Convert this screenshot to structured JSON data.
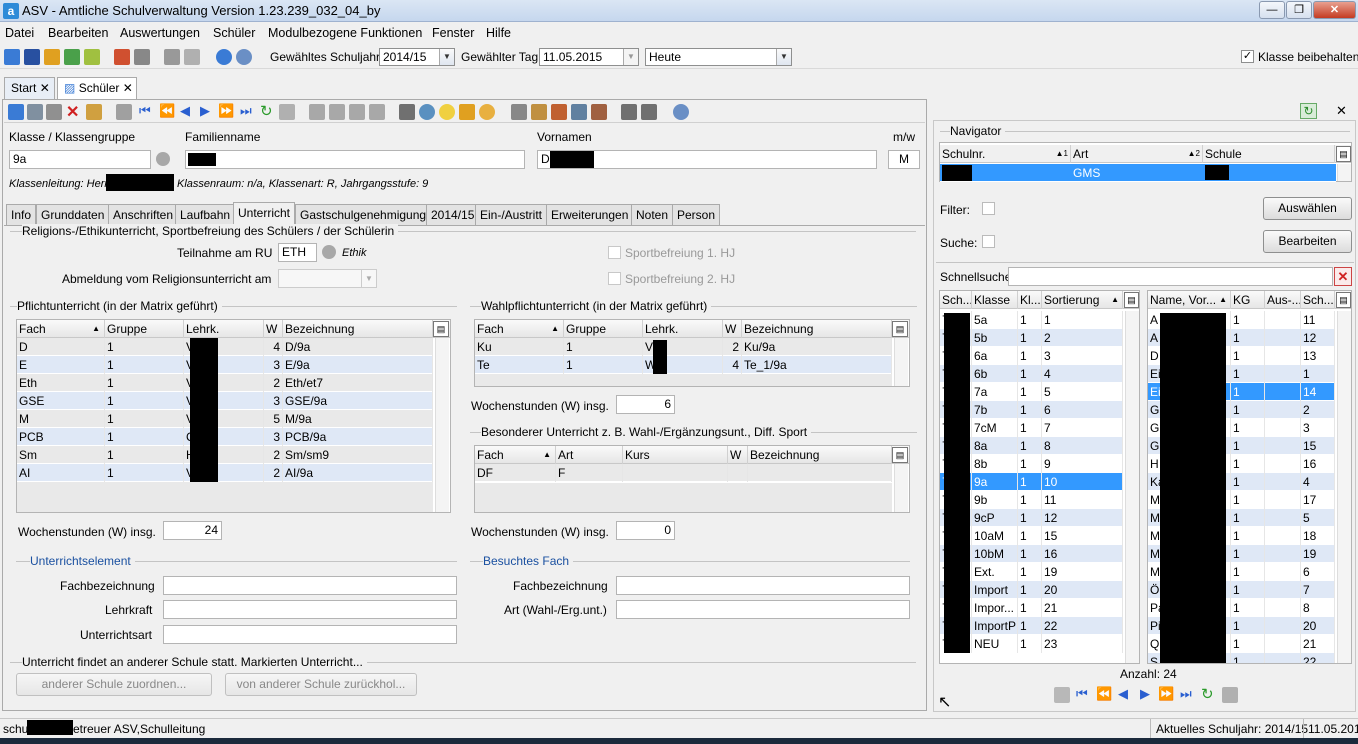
{
  "window": {
    "title": "ASV - Amtliche Schulverwaltung Version 1.23.239_032_04_by",
    "app_icon": "a"
  },
  "menu": [
    "Datei",
    "Bearbeiten",
    "Auswertungen",
    "Schüler",
    "Modulbezogene Funktionen",
    "Fenster",
    "Hilfe"
  ],
  "toolbar": {
    "schuljahr_label": "Gewähltes Schuljahr",
    "schuljahr_value": "2014/15",
    "tag_label": "Gewählter Tag",
    "tag_value": "11.05.2015",
    "heute_value": "Heute",
    "klasse_beibehalten": "Klasse beibehalten"
  },
  "tabs": [
    {
      "label": "Start"
    },
    {
      "label": "Schüler"
    }
  ],
  "header": {
    "klasse_label": "Klasse / Klassengruppe",
    "klasse_value": "9a",
    "familienname_label": "Familienname",
    "vornamen_label": "Vornamen",
    "vornamen_prefix": "D",
    "mw_label": "m/w",
    "mw_value": "M",
    "klassenleitung_prefix": "Klassenleitung: Herr",
    "klasseninfo": "Klassenraum: n/a, Klassenart: R, Jahrgangsstufe: 9"
  },
  "subtabs": [
    "Info",
    "Grunddaten",
    "Anschriften",
    "Laufbahn",
    "Unterricht",
    "Gastschulgenehmigung",
    "2014/15",
    "Ein-/Austritt",
    "Erweiterungen",
    "Noten",
    "Person"
  ],
  "religion": {
    "group_title": "Religions-/Ethikunterricht, Sportbefreiung des Schülers / der Schülerin",
    "teilnahme_label": "Teilnahme am RU",
    "teilnahme_value": "ETH",
    "teilnahme_hint": "Ethik",
    "abmeldung_label": "Abmeldung vom Religionsunterricht am",
    "sport1": "Sportbefreiung 1. HJ",
    "sport2": "Sportbefreiung 2. HJ"
  },
  "pflicht": {
    "title": "Pflichtunterricht (in der Matrix geführt)",
    "columns": [
      "Fach",
      "Gruppe",
      "Lehrk.",
      "W",
      "Bezeichnung"
    ],
    "rows": [
      {
        "fach": "D",
        "gruppe": "1",
        "lehrk": "V",
        "w": "4",
        "bez": "D/9a"
      },
      {
        "fach": "E",
        "gruppe": "1",
        "lehrk": "V",
        "w": "3",
        "bez": "E/9a"
      },
      {
        "fach": "Eth",
        "gruppe": "1",
        "lehrk": "V",
        "w": "2",
        "bez": "Eth/et7"
      },
      {
        "fach": "GSE",
        "gruppe": "1",
        "lehrk": "V",
        "w": "3",
        "bez": "GSE/9a"
      },
      {
        "fach": "M",
        "gruppe": "1",
        "lehrk": "V",
        "w": "5",
        "bez": "M/9a"
      },
      {
        "fach": "PCB",
        "gruppe": "1",
        "lehrk": "C",
        "w": "3",
        "bez": "PCB/9a"
      },
      {
        "fach": "Sm",
        "gruppe": "1",
        "lehrk": "H",
        "w": "2",
        "bez": "Sm/sm9"
      },
      {
        "fach": "AI",
        "gruppe": "1",
        "lehrk": "V",
        "w": "2",
        "bez": "AI/9a"
      }
    ],
    "wochenstunden_label": "Wochenstunden (W) insg.",
    "wochenstunden_value": "24"
  },
  "wahlpflicht": {
    "title": "Wahlpflichtunterricht (in der Matrix geführt)",
    "columns": [
      "Fach",
      "Gruppe",
      "Lehrk.",
      "W",
      "Bezeichnung"
    ],
    "rows": [
      {
        "fach": "Ku",
        "gruppe": "1",
        "lehrk": "V",
        "w": "2",
        "bez": "Ku/9a"
      },
      {
        "fach": "Te",
        "gruppe": "1",
        "lehrk": "W",
        "w": "4",
        "bez": "Te_1/9a"
      }
    ],
    "wochenstunden_label": "Wochenstunden (W) insg.",
    "wochenstunden_value": "6"
  },
  "besonderer": {
    "title": "Besonderer Unterricht z. B. Wahl-/Ergänzungsunt., Diff. Sport",
    "columns": [
      "Fach",
      "Art",
      "Kurs",
      "W",
      "Bezeichnung"
    ],
    "rows": [
      {
        "fach": "DF",
        "art": "F",
        "kurs": "",
        "w": "",
        "bez": ""
      }
    ],
    "wochenstunden_label": "Wochenstunden (W) insg.",
    "wochenstunden_value": "0"
  },
  "unterrichtselement": {
    "title": "Unterrichtselement",
    "fachbezeichnung": "Fachbezeichnung",
    "lehrkraft": "Lehrkraft",
    "unterrichtsart": "Unterrichtsart"
  },
  "besuchtes_fach": {
    "title": "Besuchtes Fach",
    "fachbezeichnung": "Fachbezeichnung",
    "art": "Art (Wahl-/Erg.unt.)"
  },
  "andere_schule": {
    "title": "Unterricht findet an anderer Schule statt. Markierten Unterricht...",
    "zuordnen": "anderer Schule zuordnen...",
    "zurueckholen": "von anderer Schule zurückhol..."
  },
  "navigator": {
    "title": "Navigator",
    "columns": [
      "Schulnr.",
      "Art",
      "Schule"
    ],
    "sort1": "1",
    "sort2": "2",
    "row_art": "GMS",
    "filter_label": "Filter:",
    "suche_label": "Suche:",
    "auswaehlen": "Auswählen",
    "bearbeiten": "Bearbeiten",
    "schnellsuche_label": "Schnellsuche",
    "class_columns": [
      "Sch...",
      "Klasse",
      "Kl...",
      "Sortierung"
    ],
    "classes": [
      {
        "k": "5a",
        "kl": "1",
        "s": "1"
      },
      {
        "k": "5b",
        "kl": "1",
        "s": "2"
      },
      {
        "k": "6a",
        "kl": "1",
        "s": "3"
      },
      {
        "k": "6b",
        "kl": "1",
        "s": "4"
      },
      {
        "k": "7a",
        "kl": "1",
        "s": "5"
      },
      {
        "k": "7b",
        "kl": "1",
        "s": "6"
      },
      {
        "k": "7cM",
        "kl": "1",
        "s": "7"
      },
      {
        "k": "8a",
        "kl": "1",
        "s": "8"
      },
      {
        "k": "8b",
        "kl": "1",
        "s": "9"
      },
      {
        "k": "9a",
        "kl": "1",
        "s": "10"
      },
      {
        "k": "9b",
        "kl": "1",
        "s": "11"
      },
      {
        "k": "9cP",
        "kl": "1",
        "s": "12"
      },
      {
        "k": "10aM",
        "kl": "1",
        "s": "15"
      },
      {
        "k": "10bM",
        "kl": "1",
        "s": "16"
      },
      {
        "k": "Ext.",
        "kl": "1",
        "s": "19"
      },
      {
        "k": "Import",
        "kl": "1",
        "s": "20"
      },
      {
        "k": "Impor...",
        "kl": "1",
        "s": "21"
      },
      {
        "k": "ImportP",
        "kl": "1",
        "s": "22"
      },
      {
        "k": "NEU",
        "kl": "1",
        "s": "23"
      }
    ],
    "class_sch_prefix": "7",
    "student_columns": [
      "Name, Vor...",
      "KG",
      "Aus-...",
      "Sch..."
    ],
    "students": [
      {
        "n": "A",
        "kg": "1",
        "sch": "11"
      },
      {
        "n": "A",
        "kg": "1",
        "sch": "12"
      },
      {
        "n": "D",
        "kg": "1",
        "sch": "13"
      },
      {
        "n": "Ei",
        "kg": "1",
        "sch": "1"
      },
      {
        "n": "Ei",
        "kg": "1",
        "sch": "14"
      },
      {
        "n": "G",
        "kg": "1",
        "sch": "2"
      },
      {
        "n": "G",
        "kg": "1",
        "sch": "3"
      },
      {
        "n": "G",
        "kg": "1",
        "sch": "15"
      },
      {
        "n": "H",
        "kg": "1",
        "sch": "16"
      },
      {
        "n": "Ka",
        "kg": "1",
        "sch": "4"
      },
      {
        "n": "M",
        "kg": "1",
        "sch": "17"
      },
      {
        "n": "M",
        "kg": "1",
        "sch": "5"
      },
      {
        "n": "M",
        "kg": "1",
        "sch": "18"
      },
      {
        "n": "M",
        "kg": "1",
        "sch": "19"
      },
      {
        "n": "M",
        "kg": "1",
        "sch": "6"
      },
      {
        "n": "Ö",
        "kg": "1",
        "sch": "7"
      },
      {
        "n": "Pa",
        "kg": "1",
        "sch": "8"
      },
      {
        "n": "Pi",
        "kg": "1",
        "sch": "20"
      },
      {
        "n": "Q",
        "kg": "1",
        "sch": "21"
      },
      {
        "n": "S",
        "kg": "1",
        "sch": "22"
      }
    ],
    "anzahl": "Anzahl: 24"
  },
  "status": {
    "left_prefix": "schul",
    "left_suffix": "etreuer ASV,Schulleitung",
    "schuljahr": "Aktuelles Schuljahr: 2014/15",
    "datum": "11.05.2015"
  }
}
